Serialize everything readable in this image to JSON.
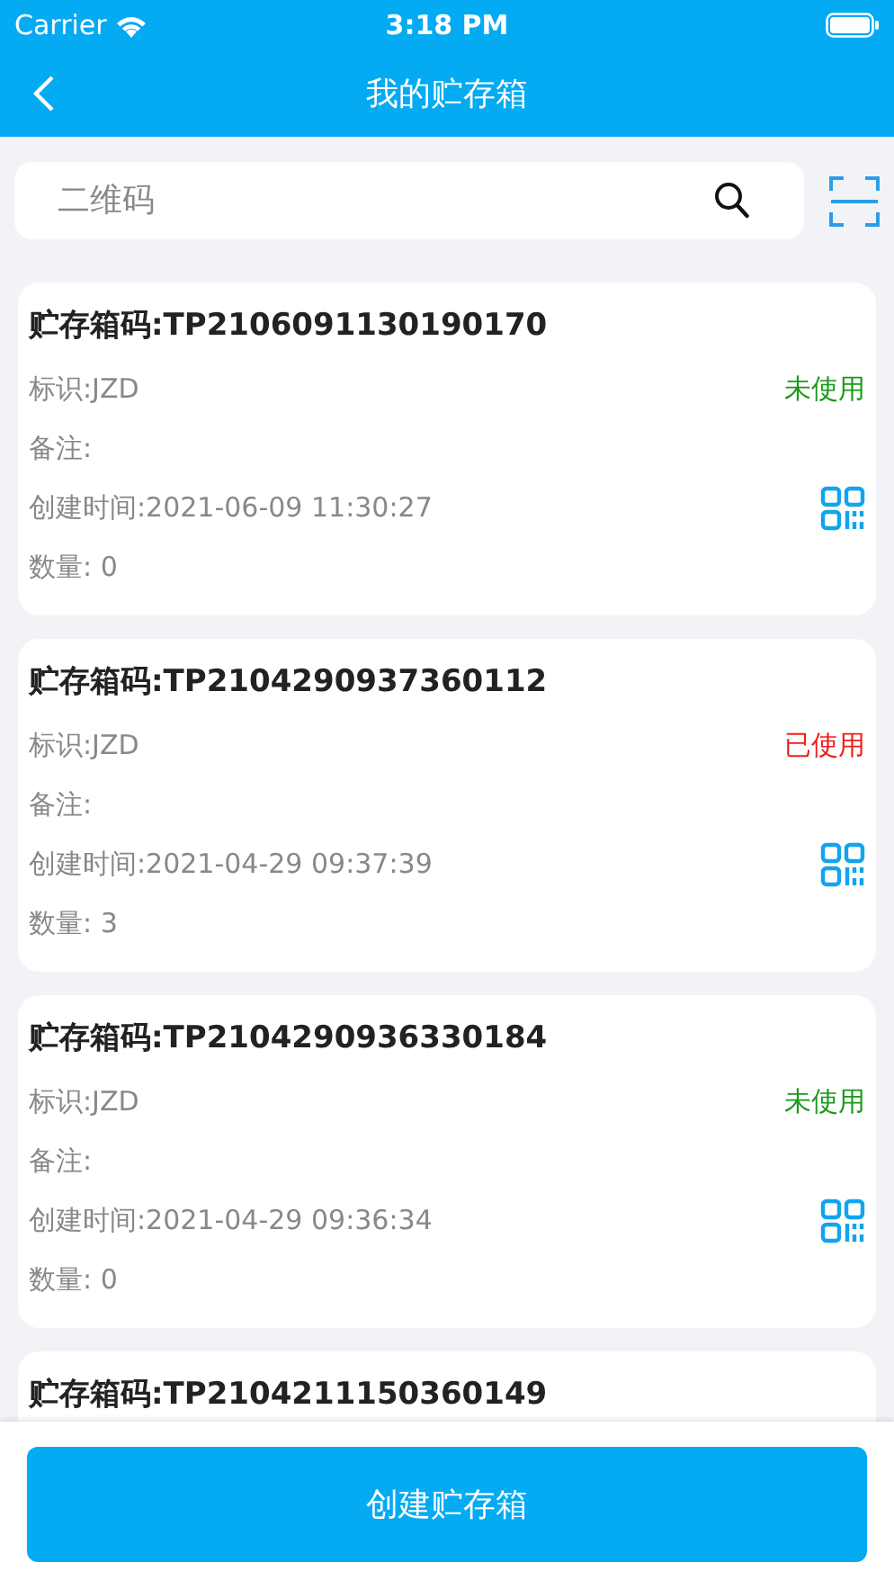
{
  "status_bar": {
    "carrier": "Carrier",
    "time": "3:18 PM"
  },
  "nav": {
    "title": "我的贮存箱"
  },
  "search": {
    "placeholder": "二维码"
  },
  "boxes": [
    {
      "code": "贮存箱码:TP2106091130190170",
      "tag": "标识:JZD",
      "status": "未使用",
      "color": "#1a9a1a",
      "note": "备注:",
      "created": "创建时间:2021-06-09 11:30:27",
      "quantity": "数量: 0"
    },
    {
      "code": "贮存箱码:TP2104290937360112",
      "tag": "标识:JZD",
      "status": "已使用",
      "color": "#f21b1b",
      "note": "备注:",
      "created": "创建时间:2021-04-29 09:37:39",
      "quantity": "数量: 3"
    },
    {
      "code": "贮存箱码:TP2104290936330184",
      "tag": "标识:JZD",
      "status": "未使用",
      "color": "#1a9a1a",
      "note": "备注:",
      "created": "创建时间:2021-04-29 09:36:34",
      "quantity": "数量: 0"
    },
    {
      "code": "贮存箱码:TP2104211150360149"
    }
  ],
  "create_button": "创建贮存箱"
}
